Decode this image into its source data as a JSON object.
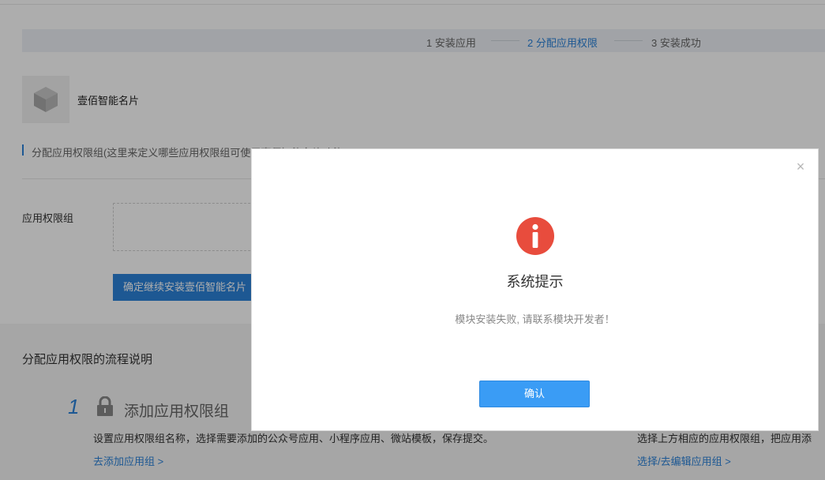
{
  "steps": [
    {
      "label": "1 安装应用"
    },
    {
      "label": "2 分配应用权限"
    },
    {
      "label": "3 安装成功"
    }
  ],
  "app": {
    "name": "壹佰智能名片"
  },
  "section": {
    "title": "分配应用权限组(这里来定义哪些应用权限组可使用壹佰智能名片功能)"
  },
  "form": {
    "field_label": "应用权限组",
    "confirm_button": "确定继续安装壹佰智能名片"
  },
  "flow": {
    "title": "分配应用权限的流程说明",
    "step1": {
      "number": "1",
      "title": "添加应用权限组",
      "description": "设置应用权限组名称，选择需要添加的公众号应用、小程序应用、微站模板，保存提交。",
      "link": "去添加应用组 >"
    },
    "step2": {
      "description": "选择上方相应的应用权限组，把应用添",
      "link": "选择/去编辑应用组 >"
    }
  },
  "modal": {
    "close_symbol": "×",
    "title": "系统提示",
    "message": "模块安装失败, 请联系模块开发者！",
    "button": "确认",
    "icon_color": "#e84c3d"
  },
  "colors": {
    "accent": "#2b82d9",
    "primary_button": "#3a9cf5"
  }
}
